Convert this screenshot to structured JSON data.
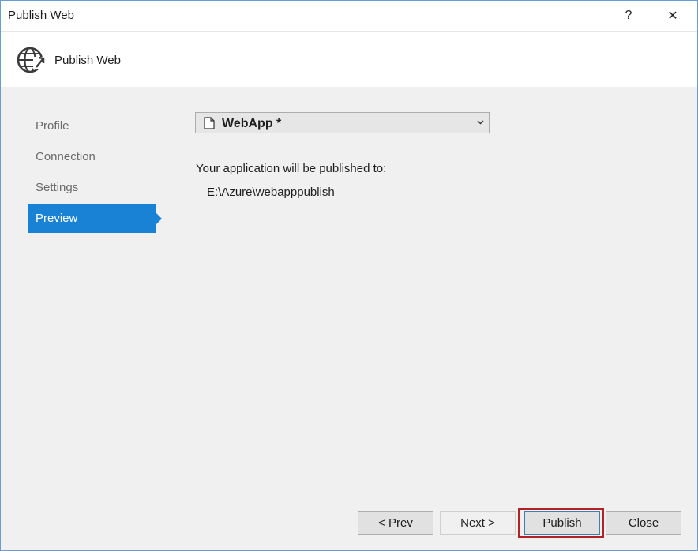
{
  "window": {
    "title": "Publish Web",
    "help_label": "?",
    "close_label": "✕"
  },
  "header": {
    "title": "Publish Web",
    "icon": "globe-publish-icon"
  },
  "nav": {
    "items": [
      {
        "label": "Profile"
      },
      {
        "label": "Connection"
      },
      {
        "label": "Settings"
      },
      {
        "label": "Preview"
      }
    ],
    "selected": "Preview"
  },
  "profile_select": {
    "value": "WebApp *",
    "icon": "document-icon"
  },
  "main": {
    "published_to_label": "Your application will be published to:",
    "published_path": "E:\\Azure\\webapppublish"
  },
  "buttons": {
    "prev": "< Prev",
    "next": "Next >",
    "publish": "Publish",
    "close": "Close"
  },
  "colors": {
    "accent": "#1a82d4",
    "highlight": "#b22222"
  }
}
